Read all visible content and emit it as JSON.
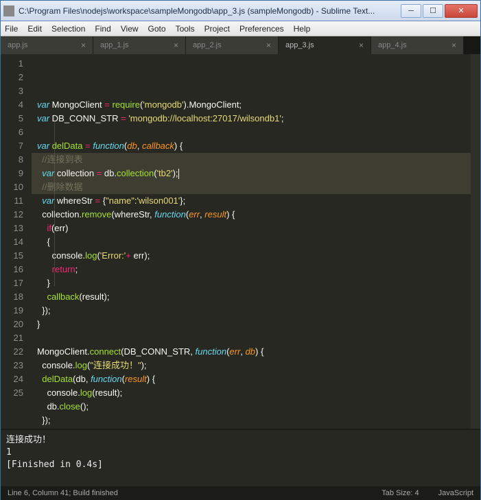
{
  "title": "C:\\Program Files\\nodejs\\workspace\\sampleMongodb\\app_3.js (sampleMongodb) - Sublime Text...",
  "menu": [
    "File",
    "Edit",
    "Selection",
    "Find",
    "View",
    "Goto",
    "Tools",
    "Project",
    "Preferences",
    "Help"
  ],
  "tabs": [
    {
      "label": "app.js",
      "active": false
    },
    {
      "label": "app_1.js",
      "active": false
    },
    {
      "label": "app_2.js",
      "active": false
    },
    {
      "label": "app_3.js",
      "active": true
    },
    {
      "label": "app_4.js",
      "active": false
    }
  ],
  "code": {
    "lines": [
      [
        [
          "k",
          "var"
        ],
        [
          "p",
          " MongoClient "
        ],
        [
          "op",
          "="
        ],
        [
          "p",
          " "
        ],
        [
          "fn",
          "require"
        ],
        [
          "p",
          "("
        ],
        [
          "str",
          "'mongodb'"
        ],
        [
          "p",
          ").MongoClient;"
        ]
      ],
      [
        [
          "k",
          "var"
        ],
        [
          "p",
          " DB_CONN_STR "
        ],
        [
          "op",
          "="
        ],
        [
          "p",
          " "
        ],
        [
          "str",
          "'mongodb://localhost:27017/wilsondb1'"
        ],
        [
          "p",
          ";"
        ]
      ],
      [],
      [
        [
          "k",
          "var"
        ],
        [
          "p",
          " "
        ],
        [
          "fn",
          "delData"
        ],
        [
          "p",
          " "
        ],
        [
          "op",
          "="
        ],
        [
          "p",
          " "
        ],
        [
          "k",
          "function"
        ],
        [
          "p",
          "("
        ],
        [
          "arg",
          "db"
        ],
        [
          "p",
          ", "
        ],
        [
          "arg",
          "callback"
        ],
        [
          "p",
          ") {"
        ]
      ],
      [
        [
          "p",
          "  "
        ],
        [
          "cm",
          "//连接到表"
        ]
      ],
      [
        [
          "p",
          "  "
        ],
        [
          "k",
          "var"
        ],
        [
          "p",
          " collection "
        ],
        [
          "op",
          "="
        ],
        [
          "p",
          " db."
        ],
        [
          "fn",
          "collection"
        ],
        [
          "p",
          "("
        ],
        [
          "str",
          "'tb2'"
        ],
        [
          "p",
          ");"
        ],
        [
          "caret",
          ""
        ]
      ],
      [
        [
          "p",
          "  "
        ],
        [
          "cm",
          "//删除数据"
        ]
      ],
      [
        [
          "p",
          "  "
        ],
        [
          "k",
          "var"
        ],
        [
          "p",
          " whereStr "
        ],
        [
          "op",
          "="
        ],
        [
          "p",
          " {"
        ],
        [
          "str",
          "\"name\""
        ],
        [
          "p",
          ":"
        ],
        [
          "str",
          "'wilson001'"
        ],
        [
          "p",
          "};"
        ]
      ],
      [
        [
          "p",
          "  collection."
        ],
        [
          "fn",
          "remove"
        ],
        [
          "p",
          "(whereStr, "
        ],
        [
          "k",
          "function"
        ],
        [
          "p",
          "("
        ],
        [
          "arg",
          "err"
        ],
        [
          "p",
          ", "
        ],
        [
          "arg",
          "result"
        ],
        [
          "p",
          ") {"
        ]
      ],
      [
        [
          "p",
          "    "
        ],
        [
          "kw",
          "if"
        ],
        [
          "p",
          "(err)"
        ]
      ],
      [
        [
          "p",
          "    {"
        ]
      ],
      [
        [
          "p",
          "      console."
        ],
        [
          "fn",
          "log"
        ],
        [
          "p",
          "("
        ],
        [
          "str",
          "'Error:'"
        ],
        [
          "op",
          "+"
        ],
        [
          "p",
          " err);"
        ]
      ],
      [
        [
          "p",
          "      "
        ],
        [
          "kw",
          "return"
        ],
        [
          "p",
          ";"
        ]
      ],
      [
        [
          "p",
          "    }"
        ]
      ],
      [
        [
          "p",
          "    "
        ],
        [
          "fn",
          "callback"
        ],
        [
          "p",
          "(result);"
        ]
      ],
      [
        [
          "p",
          "  });"
        ]
      ],
      [
        [
          "p",
          "}"
        ]
      ],
      [],
      [
        [
          "p",
          "MongoClient."
        ],
        [
          "fn",
          "connect"
        ],
        [
          "p",
          "(DB_CONN_STR, "
        ],
        [
          "k",
          "function"
        ],
        [
          "p",
          "("
        ],
        [
          "arg",
          "err"
        ],
        [
          "p",
          ", "
        ],
        [
          "arg",
          "db"
        ],
        [
          "p",
          ") {"
        ]
      ],
      [
        [
          "p",
          "  console."
        ],
        [
          "fn",
          "log"
        ],
        [
          "p",
          "("
        ],
        [
          "str",
          "\"连接成功！\""
        ],
        [
          "p",
          ");"
        ]
      ],
      [
        [
          "p",
          "  "
        ],
        [
          "fn",
          "delData"
        ],
        [
          "p",
          "(db, "
        ],
        [
          "k",
          "function"
        ],
        [
          "p",
          "("
        ],
        [
          "arg",
          "result"
        ],
        [
          "p",
          ") {"
        ]
      ],
      [
        [
          "p",
          "    console."
        ],
        [
          "fn",
          "log"
        ],
        [
          "p",
          "(result);"
        ]
      ],
      [
        [
          "p",
          "    db."
        ],
        [
          "fn",
          "close"
        ],
        [
          "p",
          "();"
        ]
      ],
      [
        [
          "p",
          "  });"
        ]
      ],
      [
        [
          "p",
          "});"
        ]
      ]
    ],
    "highlighted": [
      5,
      6,
      7
    ],
    "caretLine": 6
  },
  "consoleLines": [
    "连接成功！",
    "1",
    "[Finished in 0.4s]"
  ],
  "status": {
    "left": "Line 6, Column 41; Build finished",
    "tabsize": "Tab Size: 4",
    "syntax": "JavaScript"
  }
}
